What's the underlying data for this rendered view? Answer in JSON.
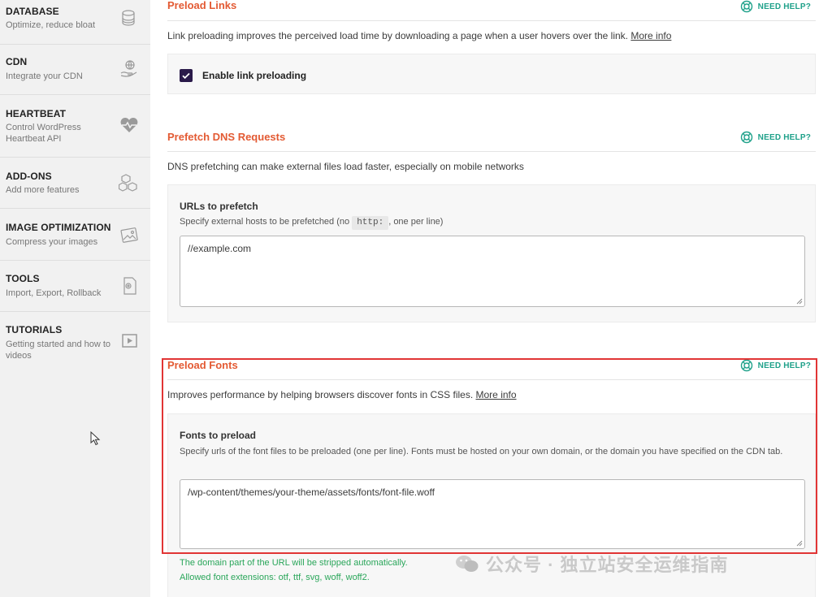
{
  "sidebar": {
    "items": [
      {
        "title": "DATABASE",
        "subtitle": "Optimize, reduce bloat",
        "icon": "database-icon"
      },
      {
        "title": "CDN",
        "subtitle": "Integrate your CDN",
        "icon": "cdn-hand-icon"
      },
      {
        "title": "HEARTBEAT",
        "subtitle": "Control WordPress Heartbeat API",
        "icon": "heartbeat-icon"
      },
      {
        "title": "ADD-ONS",
        "subtitle": "Add more features",
        "icon": "cubes-icon"
      },
      {
        "title": "IMAGE OPTIMIZATION",
        "subtitle": "Compress your images",
        "icon": "image-optimization-icon"
      },
      {
        "title": "TOOLS",
        "subtitle": "Import, Export, Rollback",
        "icon": "tools-icon"
      },
      {
        "title": "TUTORIALS",
        "subtitle": "Getting started and how to videos",
        "icon": "play-icon"
      }
    ]
  },
  "sections": {
    "preload_links": {
      "title": "Preload Links",
      "help": "NEED HELP?",
      "description": "Link preloading improves the perceived load time by downloading a page when a user hovers over the link.",
      "more_info": "More info",
      "checkbox_label": "Enable link preloading",
      "checked": true
    },
    "prefetch_dns": {
      "title": "Prefetch DNS Requests",
      "help": "NEED HELP?",
      "description": "DNS prefetching can make external files load faster, especially on mobile networks",
      "field_title": "URLs to prefetch",
      "field_desc_pre": "Specify external hosts to be prefetched (no",
      "field_desc_code": "http:",
      "field_desc_post": ", one per line)",
      "textarea_value": "//example.com"
    },
    "preload_fonts": {
      "title": "Preload Fonts",
      "help": "NEED HELP?",
      "description": "Improves performance by helping browsers discover fonts in CSS files.",
      "more_info": "More info",
      "field_title": "Fonts to preload",
      "field_desc": "Specify urls of the font files to be preloaded (one per line). Fonts must be hosted on your own domain, or the domain you have specified on the CDN tab.",
      "textarea_value": "/wp-content/themes/your-theme/assets/fonts/font-file.woff",
      "note_line1": "The domain part of the URL will be stripped automatically.",
      "note_line2": "Allowed font extensions: otf, ttf, svg, woff, woff2."
    }
  },
  "watermark": "公众号 · 独立站安全运维指南",
  "colors": {
    "accent": "#e35a33",
    "help": "#1fa18a",
    "highlight": "#e13535",
    "note": "#2aa65a",
    "checkbox": "#2a1a4a"
  }
}
